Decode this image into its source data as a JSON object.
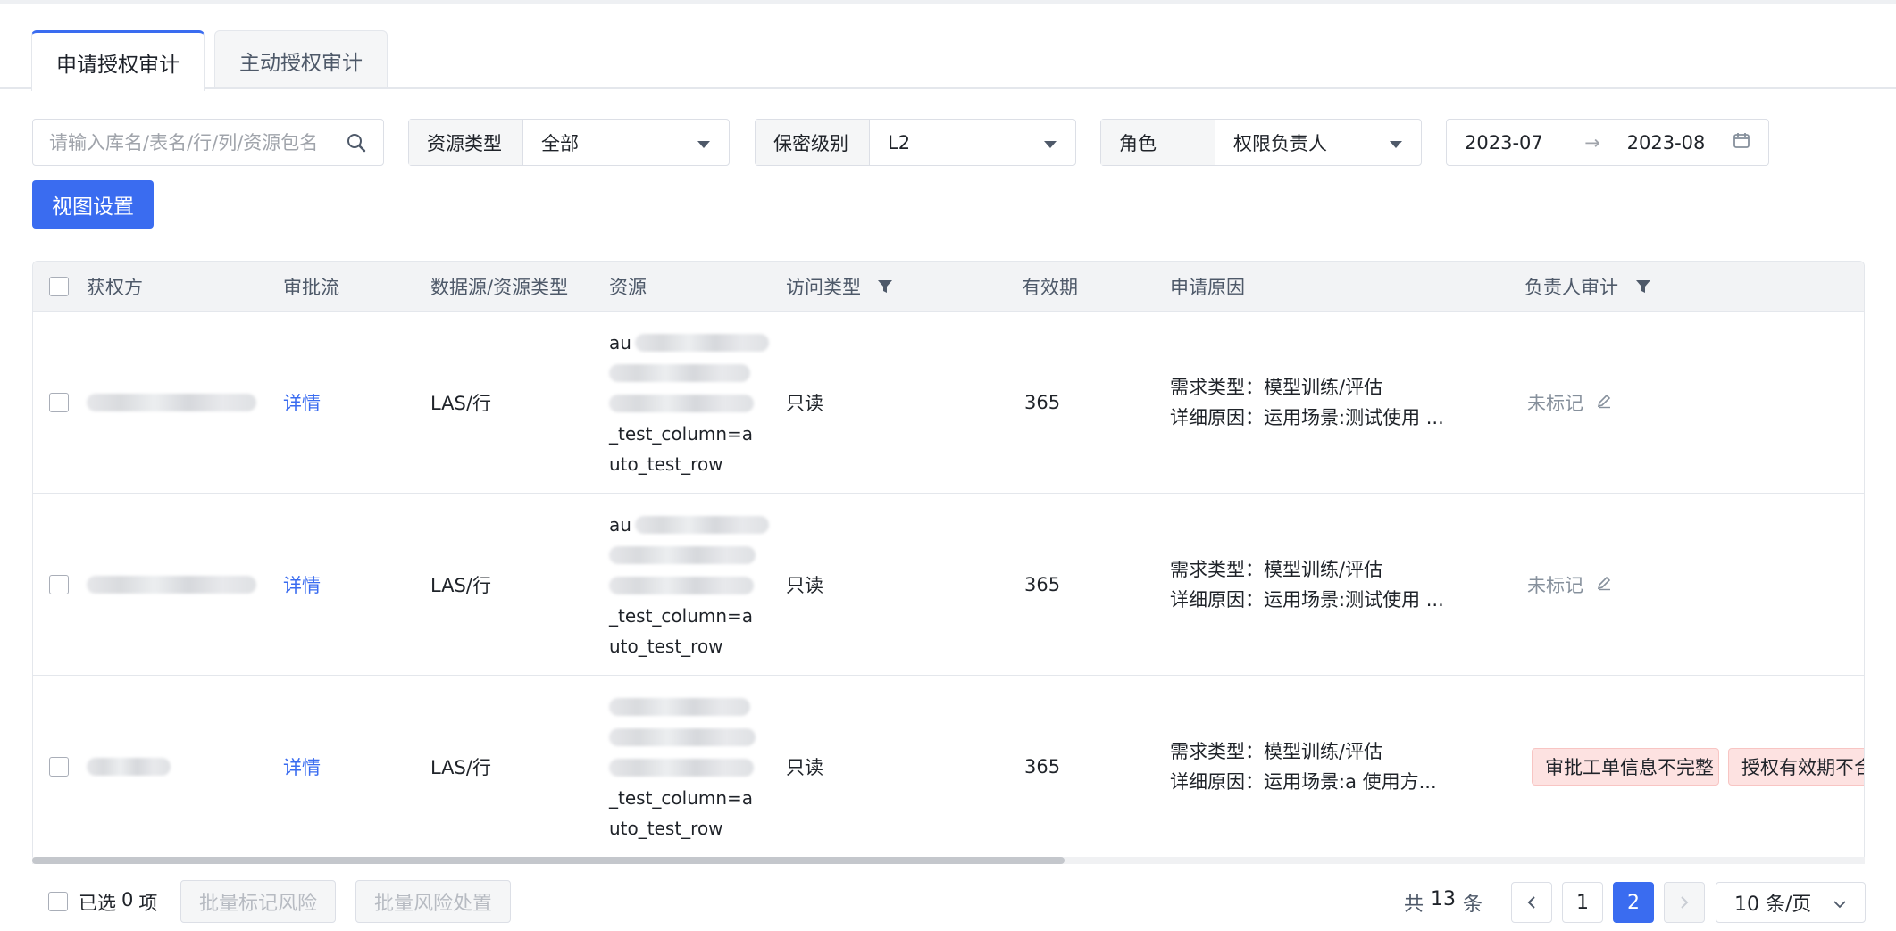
{
  "tabs": [
    {
      "label": "申请授权审计",
      "active": true
    },
    {
      "label": "主动授权审计",
      "active": false
    }
  ],
  "filters": {
    "search_placeholder": "请输入库名/表名/行/列/资源包名",
    "resource_type": {
      "label": "资源类型",
      "value": "全部"
    },
    "security_level": {
      "label": "保密级别",
      "value": "L2"
    },
    "role": {
      "label": "角色",
      "value": "权限负责人"
    },
    "date_start": "2023-07",
    "date_end": "2023-08",
    "date_separator": "→"
  },
  "view_settings_label": "视图设置",
  "table": {
    "columns": [
      "获权方",
      "审批流",
      "数据源/资源类型",
      "资源",
      "访问类型",
      "有效期",
      "申请原因",
      "负责人审计"
    ],
    "filter_columns": [
      "访问类型",
      "负责人审计"
    ],
    "rows": [
      {
        "approval": "详情",
        "source_type": "LAS/行",
        "resource_tail": [
          "_test_column=a",
          "uto_test_row"
        ],
        "resource_head": "au",
        "access": "只读",
        "validity": "365",
        "reason_type": "需求类型：模型训练/评估",
        "reason_detail": "详细原因：运用场景:测试使用 ...",
        "audit": "未标记"
      },
      {
        "approval": "详情",
        "source_type": "LAS/行",
        "resource_tail": [
          "_test_column=a",
          "uto_test_row"
        ],
        "resource_head": "au",
        "access": "只读",
        "validity": "365",
        "reason_type": "需求类型：模型训练/评估",
        "reason_detail": "详细原因：运用场景:测试使用 ...",
        "audit": "未标记"
      },
      {
        "approval": "详情",
        "source_type": "LAS/行",
        "resource_tail": [
          "_test_column=a",
          "uto_test_row"
        ],
        "resource_head": "",
        "access": "只读",
        "validity": "365",
        "reason_type": "需求类型：模型训练/评估",
        "reason_detail": "详细原因：运用场景:a 使用方...",
        "audit_tags": [
          "审批工单信息不完整",
          "授权有效期不合"
        ]
      }
    ]
  },
  "footer": {
    "selected_prefix": "已选",
    "selected_count": "0",
    "selected_suffix": "项",
    "batch_mark_label": "批量标记风险",
    "batch_handle_label": "批量风险处置",
    "total_prefix": "共",
    "total_count": "13",
    "total_suffix": "条",
    "pages": [
      "1",
      "2"
    ],
    "current_page": "2",
    "page_size": "10 条/页"
  },
  "colors": {
    "primary": "#3a6cf0",
    "tag_bg": "#fde2e1",
    "header_bg": "#f2f3f5"
  }
}
